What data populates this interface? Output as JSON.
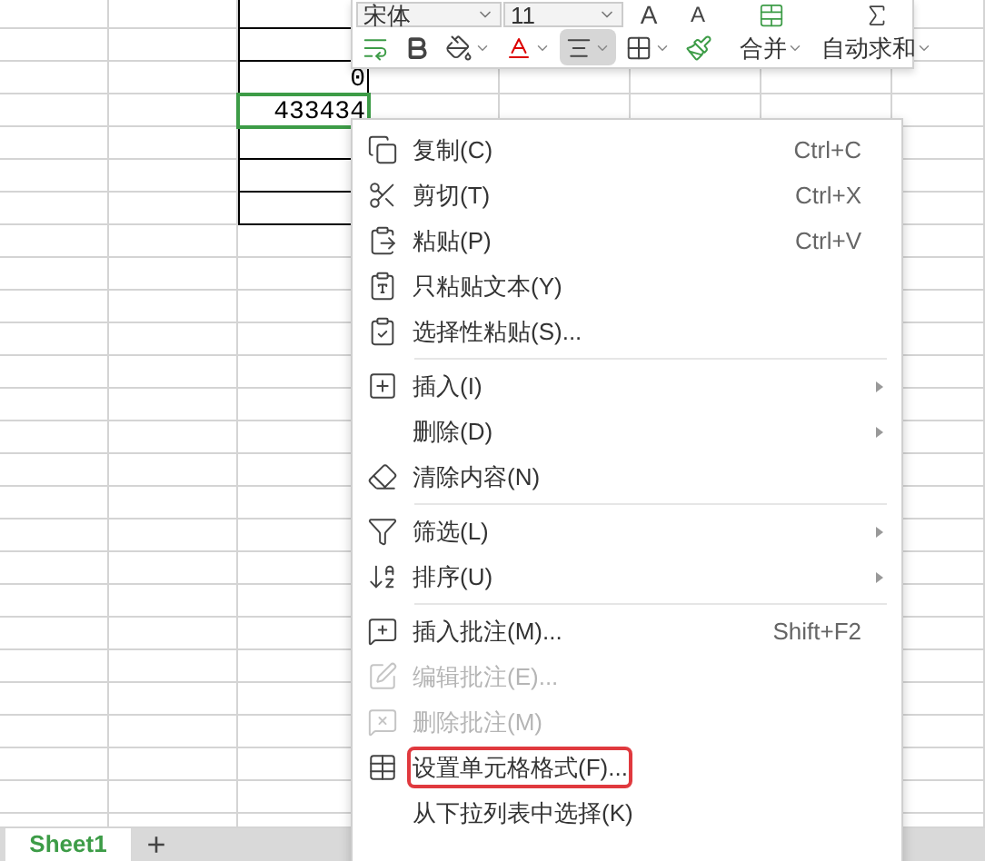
{
  "sheet": {
    "cells": [
      {
        "value": "0",
        "selected": false
      },
      {
        "value": "433434",
        "selected": true
      }
    ]
  },
  "mini_toolbar": {
    "font_name": "宋体",
    "font_size": "11",
    "grow_font": "A",
    "shrink_font": "A",
    "format_buttons": [
      {
        "selected": false
      },
      {
        "selected": false
      },
      {
        "selected": false
      },
      {
        "selected": false
      },
      {
        "selected": true
      },
      {
        "selected": false
      },
      {
        "selected": false
      }
    ],
    "big_buttons": [
      {
        "label": "合并"
      },
      {
        "label": "自动求和"
      }
    ]
  },
  "context_menu": {
    "items": [
      {
        "kind": "item",
        "label": "复制(C)",
        "shortcut": "Ctrl+C",
        "submenu": false,
        "disabled": false,
        "highlighted": false
      },
      {
        "kind": "item",
        "label": "剪切(T)",
        "shortcut": "Ctrl+X",
        "submenu": false,
        "disabled": false,
        "highlighted": false
      },
      {
        "kind": "item",
        "label": "粘贴(P)",
        "shortcut": "Ctrl+V",
        "submenu": false,
        "disabled": false,
        "highlighted": false
      },
      {
        "kind": "item",
        "label": "只粘贴文本(Y)",
        "submenu": false,
        "disabled": false,
        "highlighted": false
      },
      {
        "kind": "item",
        "label": "选择性粘贴(S)...",
        "submenu": false,
        "disabled": false,
        "highlighted": false
      },
      {
        "kind": "separator"
      },
      {
        "kind": "item",
        "label": "插入(I)",
        "submenu": true,
        "disabled": false,
        "highlighted": false
      },
      {
        "kind": "item",
        "label": "删除(D)",
        "submenu": true,
        "disabled": false,
        "highlighted": false
      },
      {
        "kind": "item",
        "label": "清除内容(N)",
        "submenu": false,
        "disabled": false,
        "highlighted": false
      },
      {
        "kind": "separator"
      },
      {
        "kind": "item",
        "label": "筛选(L)",
        "submenu": true,
        "disabled": false,
        "highlighted": false
      },
      {
        "kind": "item",
        "label": "排序(U)",
        "submenu": true,
        "disabled": false,
        "highlighted": false
      },
      {
        "kind": "separator"
      },
      {
        "kind": "item",
        "label": "插入批注(M)...",
        "shortcut": "Shift+F2",
        "submenu": false,
        "disabled": false,
        "highlighted": false
      },
      {
        "kind": "item",
        "label": "编辑批注(E)...",
        "submenu": false,
        "disabled": true,
        "highlighted": false
      },
      {
        "kind": "item",
        "label": "删除批注(M)",
        "submenu": false,
        "disabled": true,
        "highlighted": false
      },
      {
        "kind": "item",
        "label": "设置单元格格式(F)...",
        "submenu": false,
        "disabled": false,
        "highlighted": true
      },
      {
        "kind": "item",
        "label": "从下拉列表中选择(K)",
        "submenu": false,
        "disabled": false,
        "highlighted": false
      }
    ]
  },
  "sheet_tabs": [
    {
      "label": "Sheet1",
      "selected": true
    }
  ],
  "add_sheet": "+"
}
